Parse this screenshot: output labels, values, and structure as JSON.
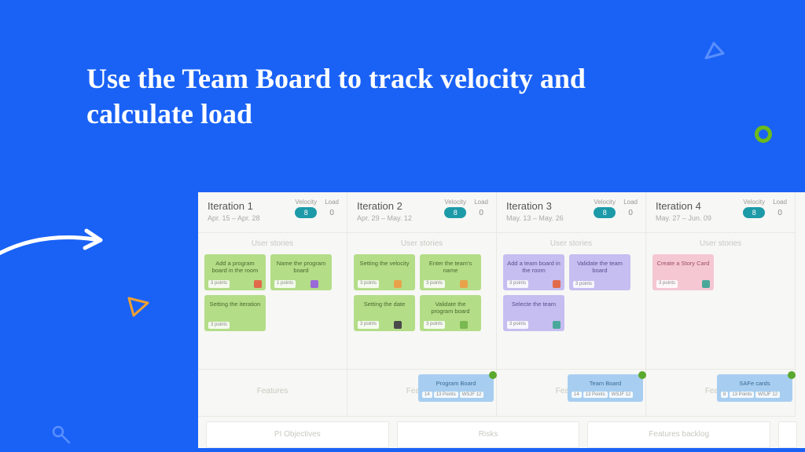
{
  "headline": "Use the Team Board to track velocity and calculate load",
  "metric_labels": {
    "velocity": "Velocity",
    "load": "Load"
  },
  "section_labels": {
    "user_stories": "User stories",
    "features": "Features"
  },
  "bottom_sections": [
    "PI Objectives",
    "Risks",
    "Features backlog"
  ],
  "iterations": [
    {
      "title": "Iteration 1",
      "dates": "Apr. 15 – Apr. 28",
      "velocity": "8",
      "load": "0",
      "stories": [
        {
          "text": "Add a program board in the room",
          "color": "green",
          "points": "3 points",
          "tags": [
            "red"
          ]
        },
        {
          "text": "Name the program board",
          "color": "green",
          "points": "1 points",
          "tags": [
            "purple",
            "teal"
          ]
        },
        {
          "text": "Setting the iteration",
          "color": "green",
          "points": "3 points",
          "tags": []
        }
      ],
      "feature": null
    },
    {
      "title": "Iteration 2",
      "dates": "Apr. 29 – May. 12",
      "velocity": "8",
      "load": "0",
      "stories": [
        {
          "text": "Setting the velocity",
          "color": "green",
          "points": "3 points",
          "tags": [
            "orange",
            "teal"
          ]
        },
        {
          "text": "Enter the team's name",
          "color": "green",
          "points": "3 points",
          "tags": [
            "orange",
            "teal"
          ]
        },
        {
          "text": "Setting the date",
          "color": "green",
          "points": "3 points",
          "tags": [
            "dark",
            "teal"
          ]
        },
        {
          "text": "Validate the program board",
          "color": "green",
          "points": "3 points",
          "tags": [
            "green2",
            "teal"
          ]
        }
      ],
      "feature": {
        "text": "Program Board",
        "chips": [
          "14",
          "13 Points",
          "WSJF 12"
        ]
      }
    },
    {
      "title": "Iteration 3",
      "dates": "May. 13 – May. 26",
      "velocity": "8",
      "load": "0",
      "stories": [
        {
          "text": "Add a team board in the room",
          "color": "purple",
          "points": "3 points",
          "tags": [
            "red"
          ]
        },
        {
          "text": "Validate the team board",
          "color": "purple",
          "points": "3 points",
          "tags": []
        },
        {
          "text": "Selecte the team",
          "color": "purple",
          "points": "3 points",
          "tags": [
            "teal"
          ]
        }
      ],
      "feature": {
        "text": "Team Board",
        "chips": [
          "14",
          "13 Points",
          "WSJF 12"
        ]
      }
    },
    {
      "title": "Iteration 4",
      "dates": "May. 27 – Jun. 09",
      "velocity": "8",
      "load": "0",
      "stories": [
        {
          "text": "Create a Story Card",
          "color": "pink",
          "points": "3 points",
          "tags": [
            "teal"
          ]
        }
      ],
      "feature": {
        "text": "SAFe cards",
        "chips": [
          "8",
          "13 Points",
          "WSJF 12"
        ]
      }
    }
  ]
}
